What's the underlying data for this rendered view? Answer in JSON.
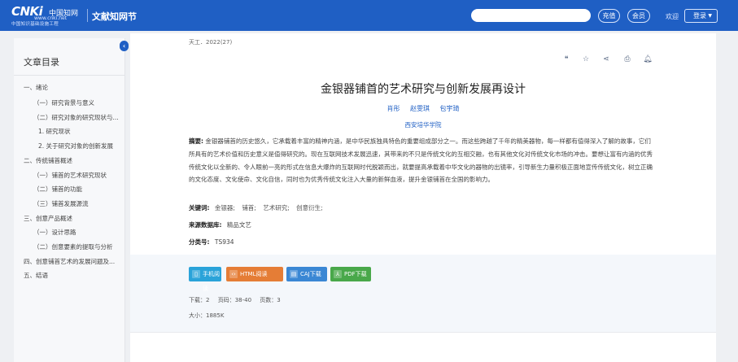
{
  "header": {
    "logo_text": "CNKi",
    "logo_cn": "中国知网",
    "logo_url": "www.cnki.net",
    "logo_sub": "中国知识基础设施工程",
    "section_title": "文献知网节",
    "search_placeholder": "",
    "recharge_label": "充值",
    "member_label": "会员",
    "welcome_text": "欢迎",
    "login_label": "登录"
  },
  "sidebar": {
    "title": "文章目录",
    "items": [
      {
        "label": "一、绪论",
        "level": 0
      },
      {
        "label": "（一）研究背景与意义",
        "level": 1
      },
      {
        "label": "（二）研究对象的研究现状与...",
        "level": 1
      },
      {
        "label": "1. 研究现状",
        "level": 2
      },
      {
        "label": "2. 关于研究对象的创新发展",
        "level": 2
      },
      {
        "label": "二、传统铺首概述",
        "level": 0
      },
      {
        "label": "（一）铺首的艺术研究现状",
        "level": 1
      },
      {
        "label": "（二）铺首的功能",
        "level": 1
      },
      {
        "label": "（三）铺首发展源流",
        "level": 1
      },
      {
        "label": "三、创意产品概述",
        "level": 0
      },
      {
        "label": "（一）设计思路",
        "level": 1
      },
      {
        "label": "（二）创意要素的提取与分析",
        "level": 1
      },
      {
        "label": "四、创意铺首艺术的发展问题及...",
        "level": 0
      },
      {
        "label": "五、结语",
        "level": 0
      }
    ]
  },
  "article": {
    "journal": "天工．2022(27)",
    "title": "金银器铺首的艺术研究与创新发展再设计",
    "authors": [
      "肖彤",
      "赵雯琪",
      "包宇琦"
    ],
    "organization": "西安培华学院",
    "abstract_label": "摘要:",
    "abstract_text": "金银器铺首的历史悠久，它承载着丰富的精神内涵，是中华民族独具特色的重要组成部分之一。而这些跨越了千年的精美器物，每一样都有值得深入了解的故事，它们所具有的艺术价值和历史意义是值得研究的。现在互联网技术发展迅速，其带来的不只是传统文化的互相交融，也有其他文化对传统文化市场的冲击。要想让富有内涵的优秀传统文化以全新的、令人眼前一亮的形式在信息大爆炸的互联网时代脱颖而出，就要提高承载着中华文化的器物的出镜率，引导新生力量积极正面地宣传传统文化，树立正确的文化态度、文化使命、文化自信，同时也为优秀传统文化注入大量的新鲜血液，提升金银铺首在全国的影响力。",
    "keywords_label": "关键词:",
    "keywords": [
      "金银器;",
      "铺首;",
      "艺术研究;",
      "创意衍生;"
    ],
    "source_label": "来源数据库:",
    "source": "精品文艺",
    "classification_label": "分类号:",
    "classification": "TS934"
  },
  "downloads": {
    "mobile_label": "手机阅读",
    "html_label": "HTML阅读",
    "caj_label": "CAJ下载",
    "pdf_label": "PDF下载",
    "downloads_text": "下载：2",
    "pages_text": "页码：38-40",
    "page_count_text": "页数：3",
    "size_text": "大小：1885K"
  },
  "icons": {
    "cite": "quote-icon",
    "favorite": "star-icon",
    "share": "share-icon",
    "print": "print-icon",
    "alert": "bell-icon"
  },
  "colors": {
    "brand_blue": "#1f5fc4",
    "mobile": "#2aa3d9",
    "html": "#e57d36",
    "caj": "#3a87d4",
    "pdf": "#49a84a"
  }
}
